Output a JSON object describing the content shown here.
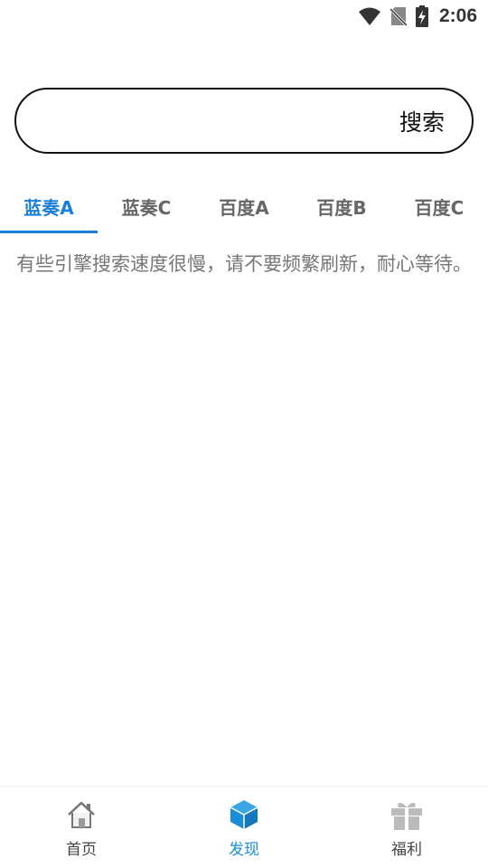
{
  "status_bar": {
    "time": "2:06",
    "icons": [
      "wifi-icon",
      "no-sim-icon",
      "battery-charging-icon"
    ]
  },
  "search": {
    "value": "",
    "placeholder": "",
    "button_label": "搜索"
  },
  "tabs": [
    {
      "label": "蓝奏A",
      "active": true
    },
    {
      "label": "蓝奏C",
      "active": false
    },
    {
      "label": "百度A",
      "active": false
    },
    {
      "label": "百度B",
      "active": false
    },
    {
      "label": "百度C",
      "active": false
    }
  ],
  "notice": "有些引擎搜索速度很慢，请不要频繁刷新，耐心等待。",
  "bottom_nav": [
    {
      "label": "首页",
      "icon": "home-icon",
      "active": false
    },
    {
      "label": "发现",
      "icon": "cube-icon",
      "active": true
    },
    {
      "label": "福利",
      "icon": "gift-icon",
      "active": false
    }
  ],
  "colors": {
    "accent": "#1a7fd8",
    "tab_inactive": "#666666",
    "notice_text": "#777777",
    "nav_active": "#1a8fd8",
    "icon_inactive": "#bbbbbb"
  }
}
